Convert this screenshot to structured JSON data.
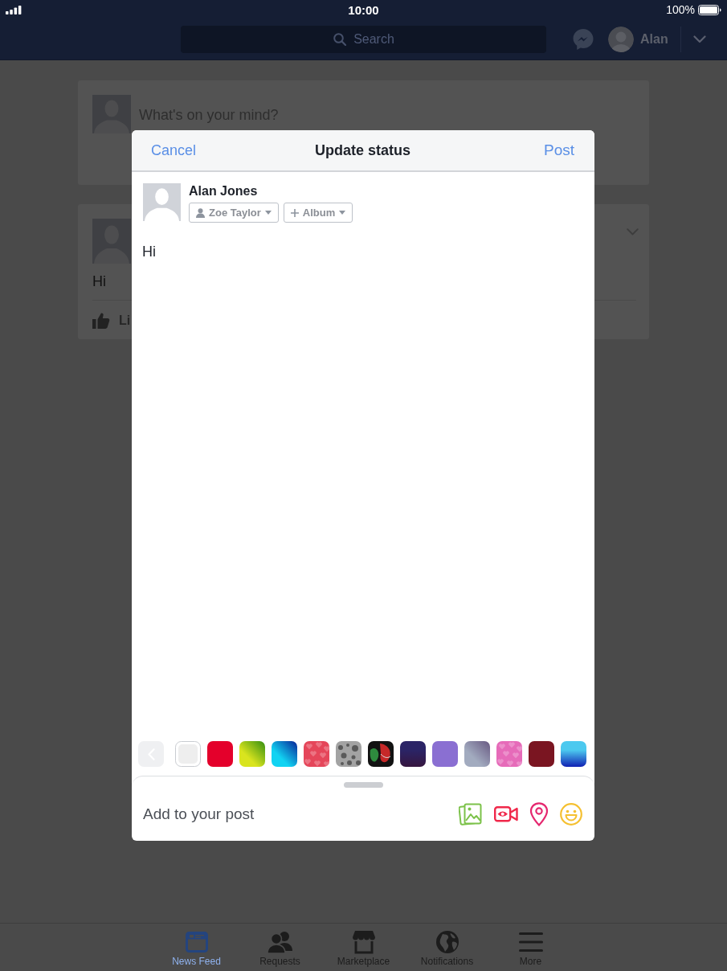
{
  "status_bar": {
    "time": "10:00",
    "battery": "100%"
  },
  "nav_bar": {
    "search": {
      "placeholder": "Search"
    },
    "profile_name": "Alan"
  },
  "feed": {
    "composer": {
      "placeholder": "What's on your mind?"
    },
    "post": {
      "text": "Hi",
      "like_label": "Li"
    }
  },
  "dialog": {
    "cancel": "Cancel",
    "title": "Update status",
    "submit": "Post",
    "author": "Alan Jones",
    "audience": "Zoe Taylor",
    "album": "Album",
    "status": {
      "value": "Hi"
    },
    "back_button": {
      "disabled": true
    },
    "swatches": [
      {
        "kind": "plain",
        "color": "#eeeeee",
        "selected": true
      },
      {
        "kind": "plain",
        "color": "#e4002b",
        "selected": false
      },
      {
        "kind": "diagonal",
        "color": "#d9e41e",
        "selected": false
      },
      {
        "kind": "diagonal",
        "color": "#11d3f2",
        "selected": false
      },
      {
        "kind": "hearts",
        "color": "#e5465a",
        "selected": false
      },
      {
        "kind": "spots",
        "color": "#a3a3a3",
        "selected": false
      },
      {
        "kind": "swirl",
        "color": "#121212",
        "selected": false
      },
      {
        "kind": "gradient",
        "color": "#2b2466",
        "selected": false
      },
      {
        "kind": "plain",
        "color": "#8a6fd2",
        "selected": false
      },
      {
        "kind": "diagonal",
        "color": "#a2abbf",
        "selected": false
      },
      {
        "kind": "hearts",
        "color": "#e66bb9",
        "selected": false
      },
      {
        "kind": "plain",
        "color": "#7a1521",
        "selected": false
      },
      {
        "kind": "gradient",
        "color": "#4cc9ef",
        "selected": false
      }
    ],
    "add_to_post": "Add to your post"
  },
  "tab_bar": [
    {
      "label": "News Feed",
      "selected": true
    },
    {
      "label": "Requests",
      "selected": false
    },
    {
      "label": "Marketplace",
      "selected": false
    },
    {
      "label": "Notifications",
      "selected": false
    },
    {
      "label": "More",
      "selected": false
    }
  ]
}
